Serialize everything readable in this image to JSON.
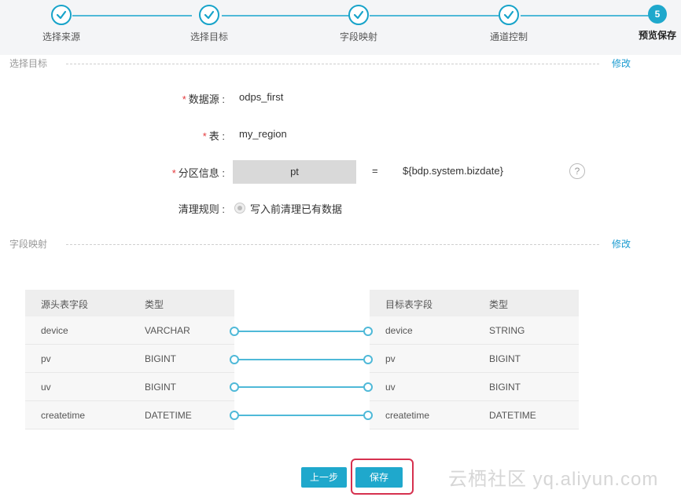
{
  "steps": [
    {
      "label": "选择来源",
      "state": "done"
    },
    {
      "label": "选择目标",
      "state": "done"
    },
    {
      "label": "字段映射",
      "state": "done"
    },
    {
      "label": "通道控制",
      "state": "done"
    },
    {
      "label": "预览保存",
      "state": "current",
      "number": "5"
    }
  ],
  "target_section": {
    "title": "选择目标",
    "edit_label": "修改"
  },
  "form": {
    "datasource": {
      "required_mark": "*",
      "label": "数据源 :",
      "value": "odps_first"
    },
    "table": {
      "required_mark": "*",
      "label": "表 :",
      "value": "my_region"
    },
    "partition": {
      "required_mark": "*",
      "label": "分区信息 :",
      "key": "pt",
      "equals": "=",
      "value": "${bdp.system.bizdate}",
      "help_icon": "?"
    },
    "cleanup": {
      "label": "清理规则 :",
      "option": "写入前清理已有数据"
    }
  },
  "mapping_section": {
    "title": "字段映射",
    "edit_label": "修改"
  },
  "source_table": {
    "headers": [
      "源头表字段",
      "类型"
    ],
    "rows": [
      [
        "device",
        "VARCHAR"
      ],
      [
        "pv",
        "BIGINT"
      ],
      [
        "uv",
        "BIGINT"
      ],
      [
        "createtime",
        "DATETIME"
      ]
    ]
  },
  "target_table": {
    "headers": [
      "目标表字段",
      "类型"
    ],
    "rows": [
      [
        "device",
        "STRING"
      ],
      [
        "pv",
        "BIGINT"
      ],
      [
        "uv",
        "BIGINT"
      ],
      [
        "createtime",
        "DATETIME"
      ]
    ]
  },
  "buttons": {
    "prev": "上一步",
    "save": "保存"
  },
  "watermark": "云栖社区 yq.aliyun.com",
  "colors": {
    "accent": "#1fa8cc",
    "highlight": "#d6314f",
    "required": "#e4393c"
  }
}
